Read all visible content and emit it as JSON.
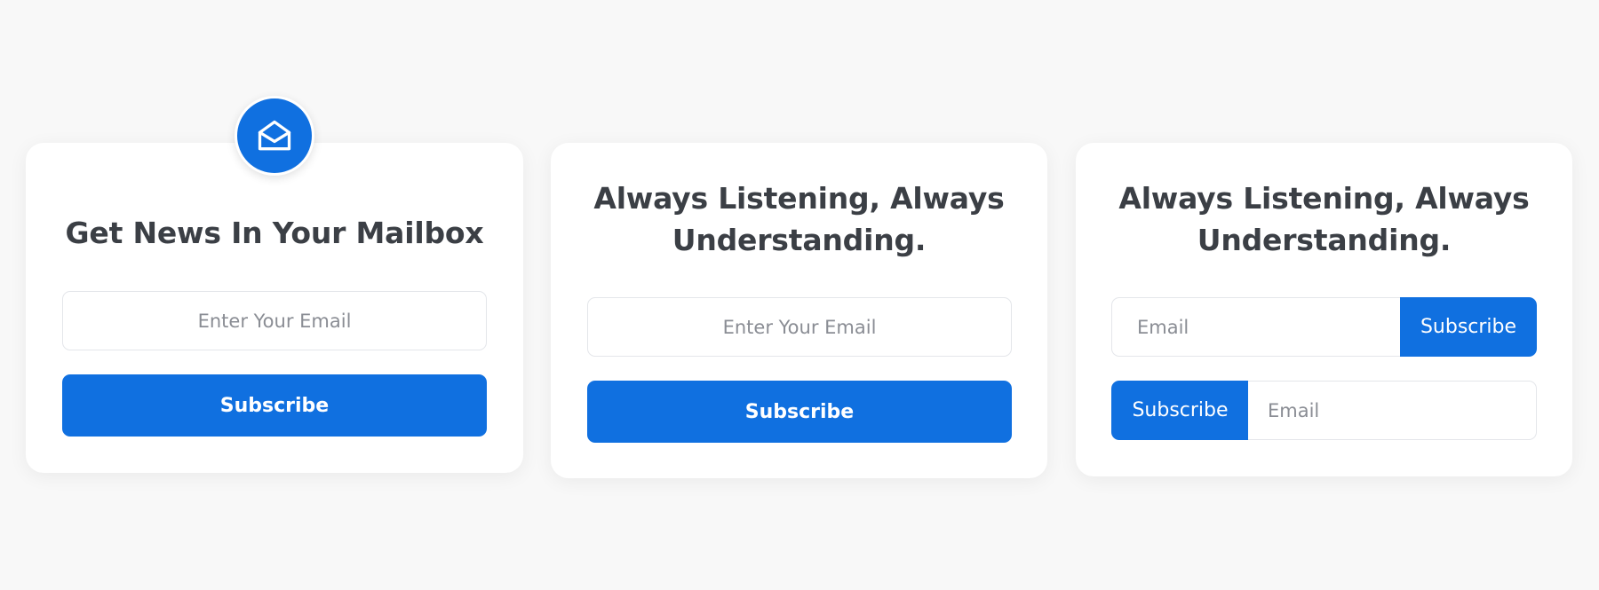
{
  "colors": {
    "page_background": "#f8f8f8",
    "card_background": "#ffffff",
    "accent": "#1070e0",
    "heading_text": "#3b3f45",
    "placeholder_text": "#8a8d94"
  },
  "card1": {
    "icon": "mail-open-icon",
    "title": "Get News In Your Mailbox",
    "email_placeholder": "Enter Your Email",
    "button_label": "Subscribe"
  },
  "card2": {
    "title": "Always Listening, Always Understanding.",
    "email_placeholder": "Enter Your Email",
    "button_label": "Subscribe"
  },
  "card3": {
    "title": "Always Listening, Always Understanding.",
    "row1": {
      "email_placeholder": "Email",
      "button_label": "Subscribe"
    },
    "row2": {
      "button_label": "Subscribe",
      "email_placeholder": "Email"
    }
  }
}
